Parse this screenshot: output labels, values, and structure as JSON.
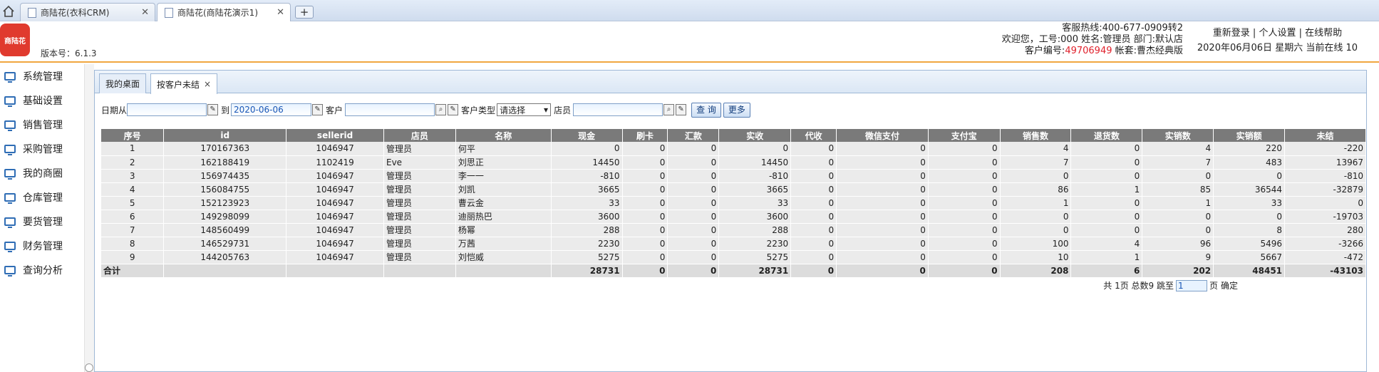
{
  "browser": {
    "tabs": [
      {
        "title": "商陆花(衣科CRM)",
        "active": false
      },
      {
        "title": "商陆花(商陆花演示1)",
        "active": true
      }
    ],
    "new_tab": "+"
  },
  "header": {
    "logo_text": "商陆花",
    "version": "版本号：6.1.3",
    "hotline": "客服热线:400-677-0909转2",
    "welcome": "欢迎您，工号:000 姓名:管理员 部门:默认店",
    "customer_no_label": "客户编号:",
    "customer_no": "49706949",
    "account": " 帐套:曹杰经典版",
    "links": {
      "relogin": "重新登录",
      "settings": "个人设置",
      "help": "在线帮助",
      "sep": " | "
    },
    "datetime": "2020年06月06日 星期六 当前在线 10"
  },
  "sidebar": {
    "items": [
      {
        "label": "系统管理"
      },
      {
        "label": "基础设置"
      },
      {
        "label": "销售管理"
      },
      {
        "label": "采购管理"
      },
      {
        "label": "我的商圈"
      },
      {
        "label": "仓库管理"
      },
      {
        "label": "要货管理"
      },
      {
        "label": "财务管理"
      },
      {
        "label": "查询分析"
      }
    ]
  },
  "content_tabs": [
    {
      "label": "我的桌面",
      "active": false
    },
    {
      "label": "按客户未结",
      "active": true,
      "close": "×"
    }
  ],
  "filters": {
    "date_from_label": "日期从",
    "date_from_value": "",
    "to_label": "到",
    "date_to_value": "2020-06-06",
    "customer_label": "客户",
    "customer_value": "",
    "customer_type_label": "客户类型",
    "customer_type_value": "请选择",
    "clerk_label": "店员",
    "clerk_value": "",
    "query_button": "查 询",
    "more_button": "更多"
  },
  "table": {
    "columns": [
      "序号",
      "id",
      "sellerid",
      "店员",
      "名称",
      "现金",
      "刷卡",
      "汇款",
      "实收",
      "代收",
      "微信支付",
      "支付宝",
      "销售数",
      "退货数",
      "实销数",
      "实销额",
      "未结"
    ],
    "rows": [
      [
        "1",
        "170167363",
        "1046947",
        "管理员",
        "何平",
        "0",
        "0",
        "0",
        "0",
        "0",
        "0",
        "0",
        "4",
        "0",
        "4",
        "220",
        "-220"
      ],
      [
        "2",
        "162188419",
        "1102419",
        "Eve",
        "刘思正",
        "14450",
        "0",
        "0",
        "14450",
        "0",
        "0",
        "0",
        "7",
        "0",
        "7",
        "483",
        "13967"
      ],
      [
        "3",
        "156974435",
        "1046947",
        "管理员",
        "李一一",
        "-810",
        "0",
        "0",
        "-810",
        "0",
        "0",
        "0",
        "0",
        "0",
        "0",
        "0",
        "-810"
      ],
      [
        "4",
        "156084755",
        "1046947",
        "管理员",
        "刘凯",
        "3665",
        "0",
        "0",
        "3665",
        "0",
        "0",
        "0",
        "86",
        "1",
        "85",
        "36544",
        "-32879"
      ],
      [
        "5",
        "152123923",
        "1046947",
        "管理员",
        "曹云金",
        "33",
        "0",
        "0",
        "33",
        "0",
        "0",
        "0",
        "1",
        "0",
        "1",
        "33",
        "0"
      ],
      [
        "6",
        "149298099",
        "1046947",
        "管理员",
        "迪丽热巴",
        "3600",
        "0",
        "0",
        "3600",
        "0",
        "0",
        "0",
        "0",
        "0",
        "0",
        "0",
        "-19703"
      ],
      [
        "7",
        "148560499",
        "1046947",
        "管理员",
        "杨幂",
        "288",
        "0",
        "0",
        "288",
        "0",
        "0",
        "0",
        "0",
        "0",
        "0",
        "8",
        "280"
      ],
      [
        "8",
        "146529731",
        "1046947",
        "管理员",
        "万茜",
        "2230",
        "0",
        "0",
        "2230",
        "0",
        "0",
        "0",
        "100",
        "4",
        "96",
        "5496",
        "-3266"
      ],
      [
        "9",
        "144205763",
        "1046947",
        "管理员",
        "刘恺威",
        "5275",
        "0",
        "0",
        "5275",
        "0",
        "0",
        "0",
        "10",
        "1",
        "9",
        "5667",
        "-472"
      ]
    ],
    "total": [
      "合计",
      "",
      "",
      "",
      "",
      "28731",
      "0",
      "0",
      "28731",
      "0",
      "0",
      "0",
      "208",
      "6",
      "202",
      "48451",
      "-43103"
    ]
  },
  "pager": {
    "summary": "共 1页 总数9 跳至",
    "page_value": "1",
    "page_suffix": "页",
    "confirm": "确定"
  }
}
